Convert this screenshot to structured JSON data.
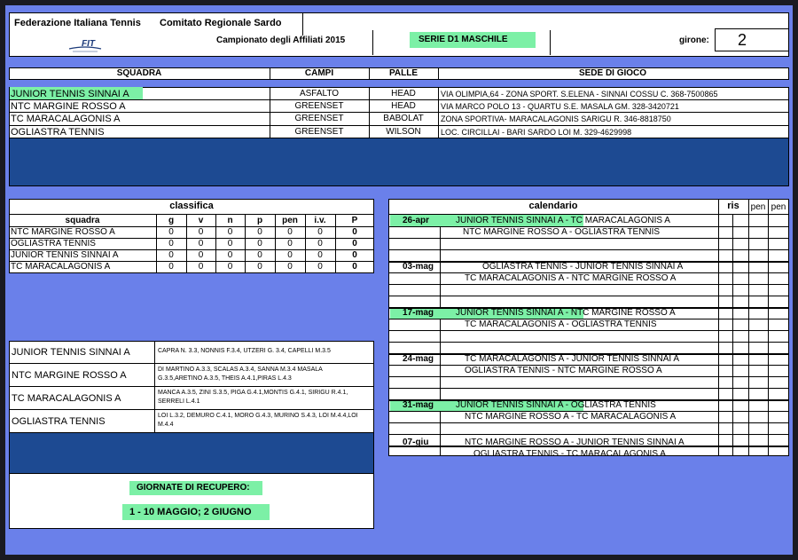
{
  "header": {
    "federation": "Federazione Italiana Tennis",
    "committee": "Comitato Regionale Sardo",
    "logo_text": "FIT",
    "championship": "Campionato degli Affiliati 2015",
    "series": "SERIE D1 MASCHILE",
    "girone_label": "girone:",
    "girone_value": "2"
  },
  "teams_table": {
    "columns": [
      "SQUADRA",
      "CAMPI",
      "PALLE",
      "SEDE DI GIOCO"
    ],
    "rows": [
      {
        "squadra": "JUNIOR TENNIS SINNAI A",
        "campi": "ASFALTO",
        "palle": "HEAD",
        "sede": "VIA OLIMPIA,64 - ZONA SPORT. S.ELENA - SINNAI COSSU C. 368-7500865"
      },
      {
        "squadra": "NTC MARGINE ROSSO A",
        "campi": "GREENSET",
        "palle": "HEAD",
        "sede": "VIA MARCO POLO 13 - QUARTU S.E. MASALA GM. 328-3420721"
      },
      {
        "squadra": "TC MARACALAGONIS A",
        "campi": "GREENSET",
        "palle": "BABOLAT",
        "sede": "ZONA SPORTIVA- MARACALAGONIS  SARIGU R. 346-8818750"
      },
      {
        "squadra": "OGLIASTRA TENNIS",
        "campi": "GREENSET",
        "palle": "WILSON",
        "sede": "LOC. CIRCILLAI - BARI SARDO LOI M. 329-4629998"
      }
    ]
  },
  "classifica": {
    "title": "classifica",
    "columns": [
      "squadra",
      "g",
      "v",
      "n",
      "p",
      "pen",
      "i.v.",
      "P"
    ],
    "rows": [
      [
        "NTC MARGINE ROSSO A",
        "0",
        "0",
        "0",
        "0",
        "0",
        "0",
        "0"
      ],
      [
        "OGLIASTRA TENNIS",
        "0",
        "0",
        "0",
        "0",
        "0",
        "0",
        "0"
      ],
      [
        "JUNIOR TENNIS SINNAI A",
        "0",
        "0",
        "0",
        "0",
        "0",
        "0",
        "0"
      ],
      [
        "TC MARACALAGONIS A",
        "0",
        "0",
        "0",
        "0",
        "0",
        "0",
        "0"
      ]
    ]
  },
  "players": [
    {
      "team": "JUNIOR TENNIS SINNAI A",
      "lines": [
        "CAPRA N. 3.3, NONNIS F.3.4, UTZERI G. 3.4, CAPELLI M.3.5"
      ]
    },
    {
      "team": "NTC MARGINE ROSSO A",
      "lines": [
        "DI MARTINO A.3.3, SCALAS A.3.4, SANNA M.3.4 MASALA",
        "G.3.5,ARETINO A.3.5, THEIS A.4.1,PIRAS L.4.3"
      ]
    },
    {
      "team": "TC MARACALAGONIS A",
      "lines": [
        "MANCA A.3.5, ZINI S.3.5, PIGA G.4.1,MONTIS G.4.1, SIRIGU R.4.1,",
        "SERRELI L.4.1"
      ]
    },
    {
      "team": "OGLIASTRA TENNIS",
      "lines": [
        "LOI L.3.2, DEMURO C.4.1, MORO G.4.3, MURINO S.4.3, LOI M.4.4,LOI",
        "M.4.4"
      ]
    }
  ],
  "recupero": {
    "label": "GIORNATE DI RECUPERO:",
    "dates": "1 - 10 MAGGIO;  2 GIUGNO"
  },
  "calendario": {
    "title": "calendario",
    "col_ris": "ris",
    "col_pen1": "pen",
    "col_pen2": "pen",
    "rounds": [
      {
        "date": "26-apr",
        "matches": [
          {
            "home": "JUNIOR TENNIS SINNAI A",
            "away": "TC MARACALAGONIS A"
          },
          {
            "home": "NTC MARGINE ROSSO A",
            "away": "OGLIASTRA TENNIS"
          }
        ]
      },
      {
        "date": "03-mag",
        "matches": [
          {
            "home": "OGLIASTRA TENNIS",
            "away": "JUNIOR TENNIS SINNAI A"
          },
          {
            "home": "TC MARACALAGONIS A",
            "away": "NTC MARGINE ROSSO A"
          }
        ]
      },
      {
        "date": "17-mag",
        "matches": [
          {
            "home": "JUNIOR TENNIS SINNAI A",
            "away": "NTC MARGINE ROSSO A"
          },
          {
            "home": "TC MARACALAGONIS A",
            "away": "OGLIASTRA TENNIS"
          }
        ]
      },
      {
        "date": "24-mag",
        "matches": [
          {
            "home": "TC MARACALAGONIS A",
            "away": "JUNIOR TENNIS SINNAI A"
          },
          {
            "home": "OGLIASTRA TENNIS",
            "away": "NTC MARGINE ROSSO A"
          }
        ]
      },
      {
        "date": "31-mag",
        "matches": [
          {
            "home": "JUNIOR TENNIS SINNAI A",
            "away": "OGLIASTRA TENNIS"
          },
          {
            "home": "NTC MARGINE ROSSO A",
            "away": "TC MARACALAGONIS A"
          }
        ]
      },
      {
        "date": "07-giu",
        "matches": [
          {
            "home": "NTC MARGINE ROSSO A",
            "away": "JUNIOR TENNIS SINNAI A"
          },
          {
            "home": "OGLIASTRA TENNIS",
            "away": "TC MARACALAGONIS A"
          }
        ]
      }
    ]
  },
  "colors": {
    "sheet": "#6a80ea",
    "dark_band": "#1d4a92",
    "highlighter": "#7cf0a6"
  }
}
